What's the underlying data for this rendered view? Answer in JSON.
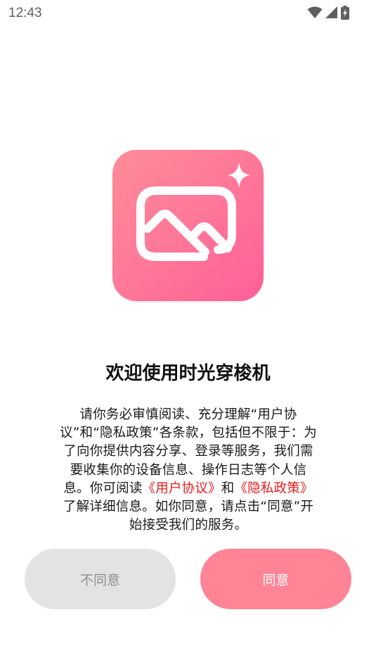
{
  "status_bar": {
    "time": "12:43",
    "icons": [
      "wifi-icon",
      "cellular-signal-icon",
      "battery-charging-icon"
    ]
  },
  "app": {
    "icon": "picture-sparkle-icon",
    "gradient_colors": [
      "#ff8c98",
      "#ff5f98"
    ]
  },
  "dialog": {
    "title": "欢迎使用时光穿梭机",
    "body_intro": "请你务必审慎阅读、充分理解“用户协议”和“隐私政策”各条款，包括但不限于：为了向你提供内容分享、登录等服务，我们需要收集你的设备信息、操作日志等个人信息。你可阅读",
    "link_user_agreement": "《用户协议》",
    "body_and": "和",
    "link_privacy_policy": "《隐私政策》",
    "body_outro": "了解详细信息。如你同意，请点击“同意”开始接受我们的服务。",
    "link_color": "#e81b1b"
  },
  "buttons": {
    "disagree_label": "不同意",
    "agree_label": "同意",
    "agree_color": "#ff8496",
    "disagree_color": "#e3e3e3"
  }
}
